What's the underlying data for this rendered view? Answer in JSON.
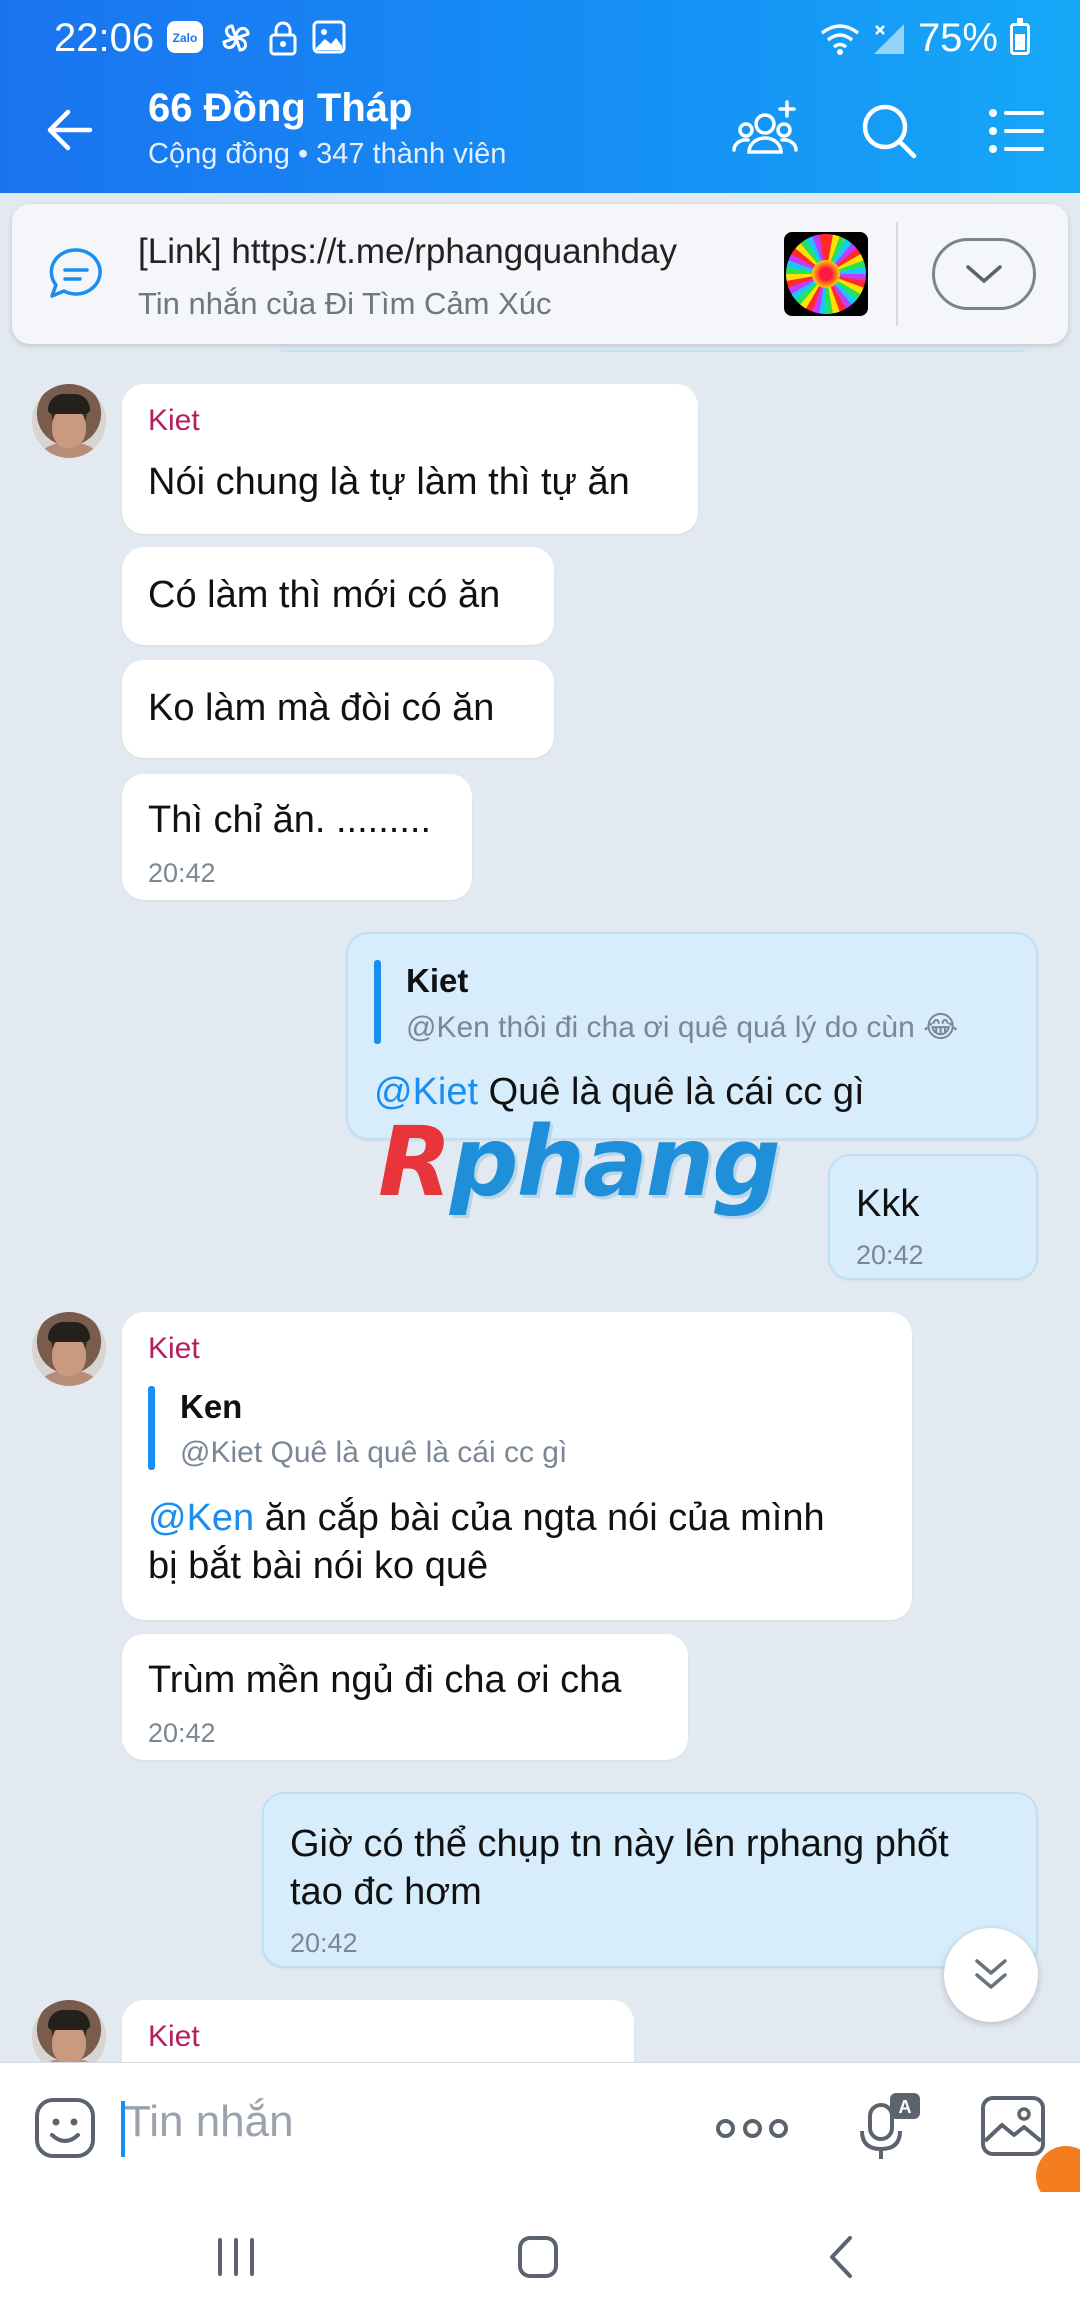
{
  "status_bar": {
    "time": "22:06",
    "battery": "75%",
    "icons": [
      "zalo-icon",
      "pinwheel-icon",
      "lock-icon",
      "image-icon",
      "wifi-icon",
      "signal-icon",
      "battery-icon"
    ]
  },
  "header": {
    "title": "66 Đồng Tháp",
    "subtitle": "Cộng đồng • 347 thành viên"
  },
  "pinned": {
    "title": "[Link] https://t.me/rphangquanhday",
    "subtitle": "Tin nhắn của Đi Tìm Cảm Xúc"
  },
  "messages": [
    {
      "sender": "Kiet",
      "text": "Nói chung là tự làm thì tự ăn"
    },
    {
      "text": "Có làm thì mới có ăn"
    },
    {
      "text": "Ko làm mà đòi có ăn"
    },
    {
      "text": "Thì chỉ ăn. .........",
      "time": "20:42"
    },
    {
      "quote_author": "Kiet",
      "quote_text": "@Ken thôi đi cha ơi quê quá lý do cùn 😂",
      "mention": "@Kiet",
      "text": " Quê là quê là cái cc gì"
    },
    {
      "text": "Kkk",
      "time": "20:42"
    },
    {
      "sender": "Kiet",
      "quote_author": "Ken",
      "quote_text": "@Kiet Quê là quê là cái cc gì",
      "mention": "@Ken",
      "text_line1": " ăn cắp bài của ngta nói của mình",
      "text_line2": "bị bắt bài nói ko quê"
    },
    {
      "text": "Trùm mền ngủ đi cha ơi cha",
      "time": "20:42"
    },
    {
      "text_line1": "Giờ có thể chụp tn này lên rphang phốt",
      "text_line2": "tao đc hơm",
      "time": "20:42"
    },
    {
      "sender": "Kiet"
    }
  ],
  "watermark": {
    "first": "R",
    "rest": "phang"
  },
  "composer": {
    "placeholder": "Tin nhắn"
  },
  "colors": {
    "header_blue": "#1a74f0",
    "sender": "#b51f5c",
    "mention": "#1a8ef0",
    "outgoing_bubble": "#d7edfc",
    "background": "#e2e9f1"
  }
}
